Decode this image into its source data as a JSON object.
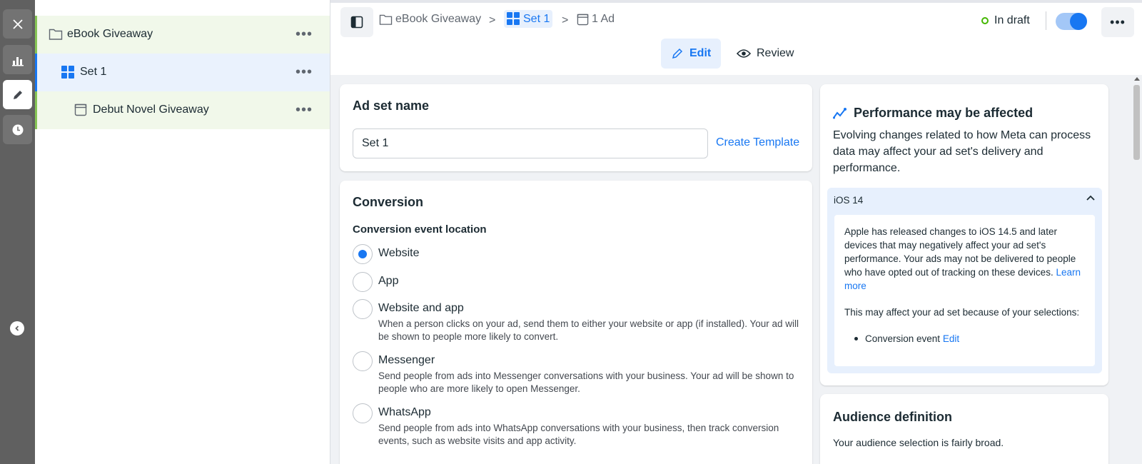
{
  "rail": {
    "close_icon": "close-icon",
    "items": [
      "chart-icon",
      "pencil-icon",
      "clock-icon"
    ],
    "collapse_icon": "chevron-left-icon"
  },
  "tree": {
    "items": [
      {
        "label": "eBook Giveaway",
        "icon": "folder-icon",
        "more": "•••"
      },
      {
        "label": "Set 1",
        "icon": "grid-icon",
        "more": "•••"
      },
      {
        "label": "Debut Novel Giveaway",
        "icon": "ad-icon",
        "more": "•••"
      }
    ]
  },
  "header": {
    "breadcrumbs": [
      {
        "label": "eBook Giveaway",
        "icon": "folder-icon"
      },
      {
        "label": "Set 1",
        "icon": "grid-icon"
      },
      {
        "label": "1 Ad",
        "icon": "ad-icon"
      }
    ],
    "separator": ">",
    "status": "In draft",
    "more": "•••",
    "tabs": [
      {
        "label": "Edit",
        "icon": "pencil-icon"
      },
      {
        "label": "Review",
        "icon": "eye-icon"
      }
    ]
  },
  "adset": {
    "title": "Ad set name",
    "name_value": "Set 1",
    "create_template": "Create Template"
  },
  "conversion": {
    "title": "Conversion",
    "location_label": "Conversion event location",
    "options": [
      {
        "label": "Website",
        "description": "",
        "checked": true
      },
      {
        "label": "App",
        "description": "",
        "checked": false
      },
      {
        "label": "Website and app",
        "description": "When a person clicks on your ad, send them to either your website or app (if installed). Your ad will be shown to people more likely to convert.",
        "checked": false
      },
      {
        "label": "Messenger",
        "description": "Send people from ads into Messenger conversations with your business. Your ad will be shown to people who are more likely to open Messenger.",
        "checked": false
      },
      {
        "label": "WhatsApp",
        "description": "Send people from ads into WhatsApp conversations with your business, then track conversion events, such as website visits and app activity.",
        "checked": false
      }
    ]
  },
  "performance": {
    "title": "Performance may be affected",
    "text": "Evolving changes related to how Meta can process data may affect your ad set's delivery and performance.",
    "ios": {
      "title": "iOS 14",
      "body": "Apple has released changes to iOS 14.5 and later devices that may negatively affect your ad set's performance. Your ads may not be delivered to people who have opted out of tracking on these devices.",
      "learn_more": "Learn more",
      "selections_text": "This may affect your ad set because of your selections:",
      "list_item": "Conversion event",
      "list_link": "Edit"
    }
  },
  "audience": {
    "title": "Audience definition",
    "text": "Your audience selection is fairly broad."
  },
  "colors": {
    "accent": "#1877f2",
    "status_dot": "#44b700",
    "rail": "#606060"
  }
}
